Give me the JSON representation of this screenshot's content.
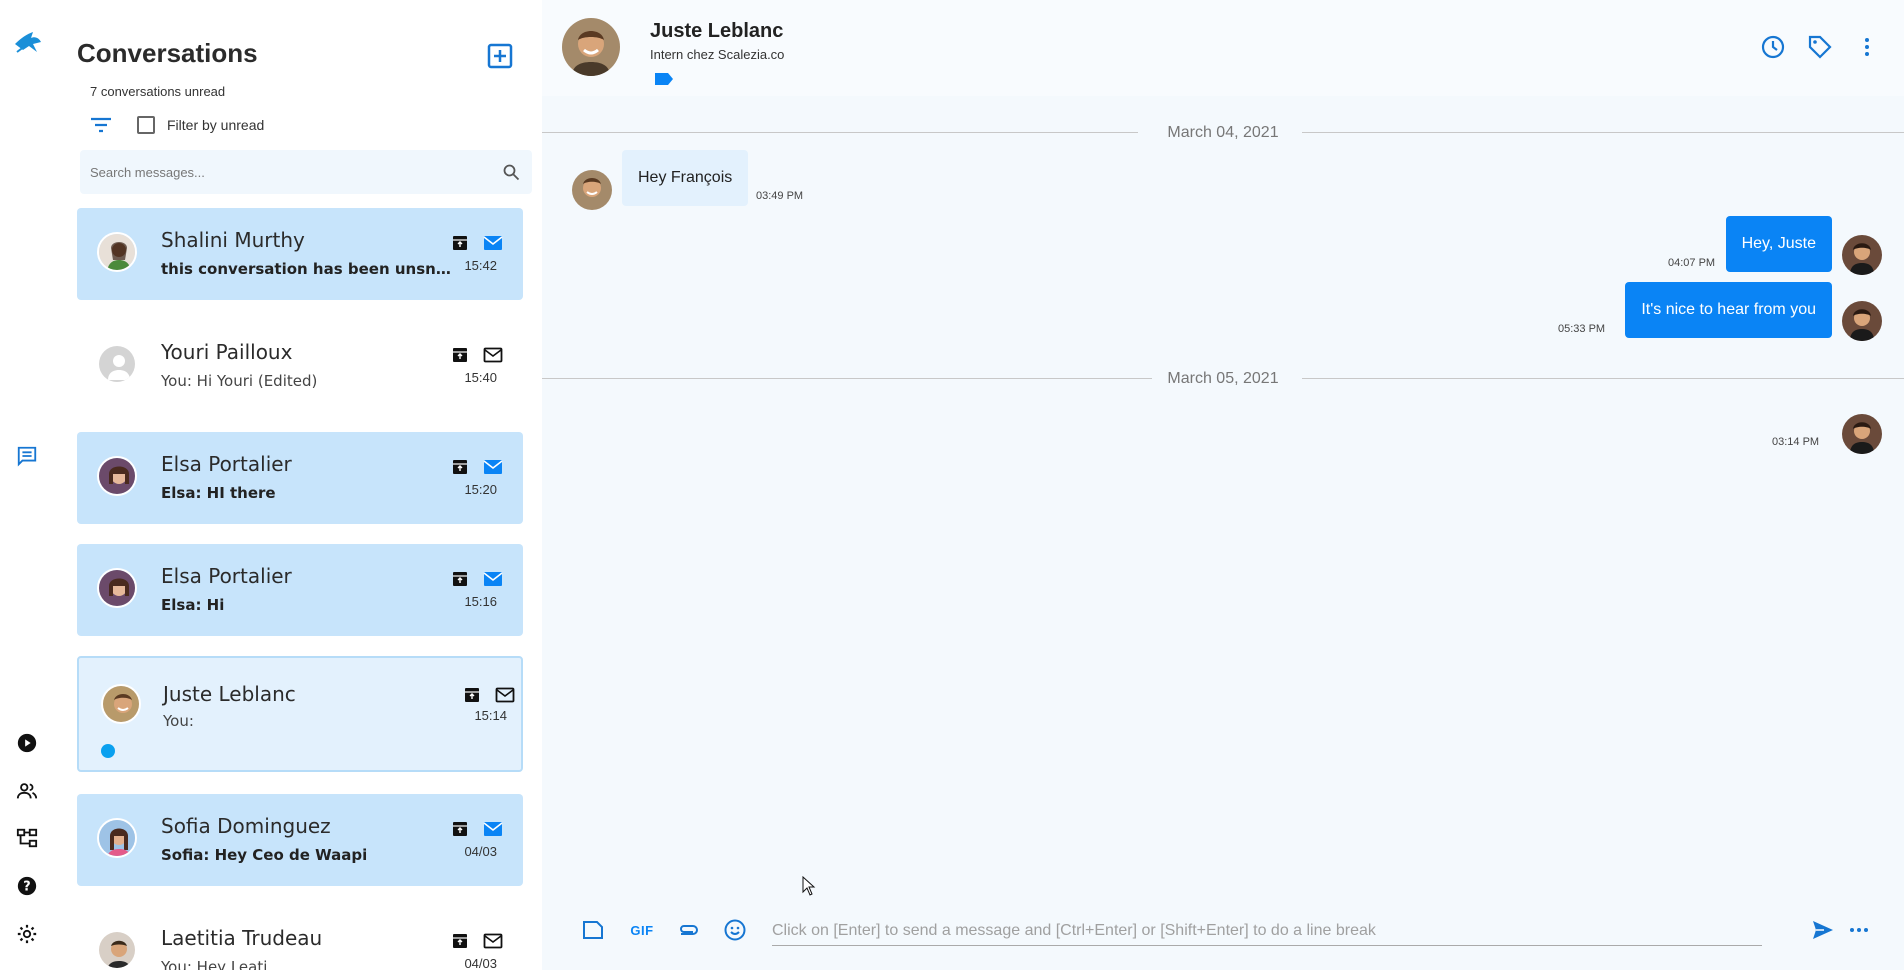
{
  "sidebar_panel": {
    "title": "Conversations",
    "unread_text": "7 conversations unread",
    "filter_label": "Filter by unread",
    "search_placeholder": "Search messages..."
  },
  "conversations": [
    {
      "name": "Shalini Murthy",
      "preview": "this conversation has been unsnoo...",
      "time": "15:42",
      "state": "unread"
    },
    {
      "name": "Youri Pailloux",
      "preview": "You: Hi Youri (Edited)",
      "time": "15:40",
      "state": "read"
    },
    {
      "name": "Elsa Portalier",
      "preview": "Elsa: HI there",
      "time": "15:20",
      "state": "unread"
    },
    {
      "name": "Elsa Portalier",
      "preview": "Elsa: Hi",
      "time": "15:16",
      "state": "unread"
    },
    {
      "name": "Juste Leblanc",
      "preview": "You:",
      "time": "15:14",
      "state": "active"
    },
    {
      "name": "Sofia Dominguez",
      "preview": "Sofia: Hey Ceo de Waapi",
      "time": "04/03",
      "state": "unread"
    },
    {
      "name": "Laetitia Trudeau",
      "preview": "You: Hey Leati",
      "time": "04/03",
      "state": "read"
    }
  ],
  "chat": {
    "contact_name": "Juste Leblanc",
    "contact_subtitle": "Intern chez Scalezia.co",
    "dates": [
      "March 04, 2021",
      "March 05, 2021"
    ],
    "messages": [
      {
        "text": "Hey François",
        "time": "03:49 PM",
        "direction": "in"
      },
      {
        "text": "Hey, Juste",
        "time": "04:07 PM",
        "direction": "out"
      },
      {
        "text": "It's nice to hear from you",
        "time": "05:33 PM",
        "direction": "out"
      },
      {
        "text": "",
        "time": "03:14 PM",
        "direction": "out"
      }
    ],
    "composer": {
      "gif_label": "GIF",
      "placeholder": "Click on [Enter] to send a message and [Ctrl+Enter] or [Shift+Enter] to do a line break"
    }
  },
  "colors": {
    "accent": "#0a84f5",
    "unread_bg": "#c7e4fb",
    "active_bg": "#e3f1fd",
    "chat_bg": "#f4f9fd",
    "icon_blue": "#1676d2"
  }
}
